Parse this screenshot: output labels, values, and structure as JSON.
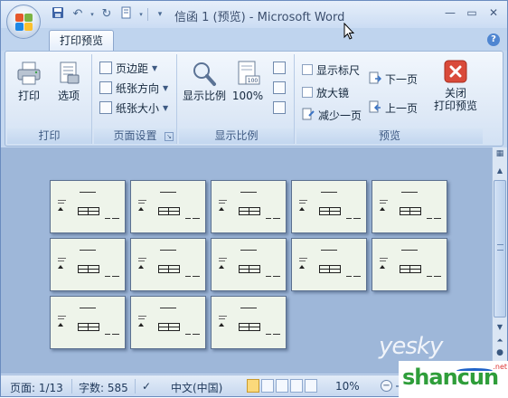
{
  "window": {
    "title": "信函 1 (预览) - Microsoft Word",
    "controls": [
      "minimize",
      "maximize",
      "close"
    ]
  },
  "qat": {
    "icons": [
      "save-icon",
      "undo-icon",
      "redo-icon",
      "print-doc-icon",
      "customize-icon"
    ]
  },
  "tabs": [
    {
      "label": "打印预览",
      "active": true
    }
  ],
  "ribbon": {
    "print_group": {
      "label": "打印",
      "print_btn": "打印",
      "options_btn": "选项"
    },
    "page_setup_group": {
      "label": "页面设置",
      "margins_btn": "页边距",
      "orientation_btn": "纸张方向",
      "size_btn": "纸张大小"
    },
    "zoom_group": {
      "label": "显示比例",
      "zoom_btn": "显示比例",
      "percent_btn": "100%",
      "percent_icon_text": "100"
    },
    "preview_group": {
      "label": "预览",
      "show_ruler": "显示标尺",
      "magnifier": "放大镜",
      "shrink_one_page": "减少一页",
      "next_page": "下一页",
      "prev_page": "上一页",
      "close_line1": "关闭",
      "close_line2": "打印预览"
    }
  },
  "document": {
    "page_count": 13
  },
  "statusbar": {
    "page": "页面: 1/13",
    "words": "字数: 585",
    "language": "中文(中国)",
    "zoom": "10%"
  },
  "watermark": {
    "yesky": "yesky",
    "shancun": "shancun",
    "net": ".net"
  },
  "colors": {
    "doc_background": "#9eb7d9",
    "page_fill": "#eef4ea",
    "ribbon_bg": "#dde8f6",
    "close_button": "#d94a3a"
  }
}
